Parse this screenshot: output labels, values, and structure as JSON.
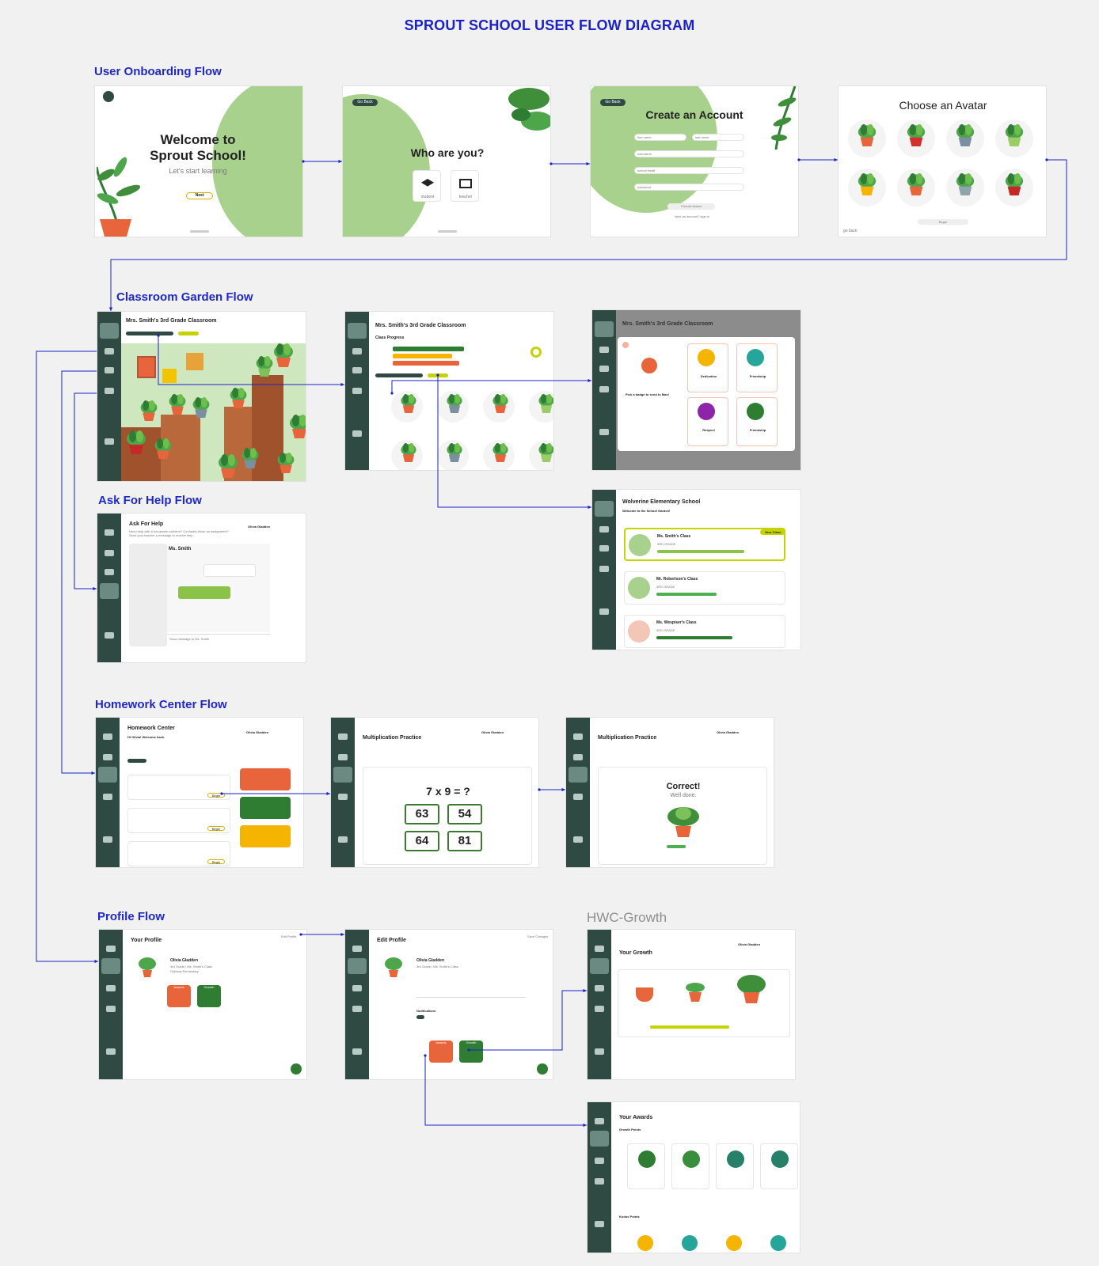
{
  "title": "SPROUT SCHOOL USER FLOW DIAGRAM",
  "sections": {
    "onboarding": "User Onboarding Flow",
    "garden": "Classroom Garden Flow",
    "help": "Ask For Help Flow",
    "homework": "Homework Center Flow",
    "profile": "Profile Flow",
    "growth": "HWC-Growth"
  },
  "screens": {
    "welcome": {
      "line1": "Welcome to",
      "line2": "Sprout School!",
      "sub": "Let's start learning",
      "button": "Next"
    },
    "who": {
      "heading": "Who are you?",
      "back": "Go Back",
      "student": "student",
      "teacher": "teacher"
    },
    "account": {
      "heading": "Create an Account",
      "back": "Go Back",
      "first": "first name",
      "last": "last name",
      "username": "username",
      "email": "school email",
      "password": "password",
      "choose": "Choose Avatar",
      "signin": "have an account? sign in"
    },
    "avatar": {
      "heading": "Choose an Avatar",
      "back": "go back",
      "begin": "Begin"
    },
    "classroom": {
      "heading": "Mrs. Smith's 3rd Grade Classroom"
    },
    "progress": {
      "heading": "Mrs. Smith's 3rd Grade Classroom",
      "sub": "Class Progress"
    },
    "badges": {
      "heading": "Mrs. Smith's 3rd Grade Classroom",
      "pick": "Pick a badge to send to Max!",
      "b1": "Dedication",
      "b2": "Friendship",
      "b3": "Respect",
      "b4": "Friendship"
    },
    "school": {
      "heading": "Wolverine Elementary School",
      "sub": "Welcome to the School Garden!",
      "c1": "Ms. Smith's Class",
      "c2": "Mr. Robertson's Class",
      "c3": "Ms. Wespiser's Class",
      "grade": "3RD GRADE",
      "yours": "Your Class"
    },
    "help": {
      "heading": "Ask For Help",
      "sub1": "Need help with a homework problem? Confused about an assignment?",
      "sub2": "Send your teacher a message to receive help.",
      "teacher": "Ms. Smith",
      "student": "Olivia Gladden",
      "placeholder": "Send message to Ms. Smith"
    },
    "homework": {
      "heading": "Homework Center",
      "hello": "Hi Olivia! Welcome back.",
      "student": "Olivia Gladden",
      "begin": "Begin"
    },
    "practice": {
      "heading": "Multiplication Practice",
      "equation": "7 x 9 = ?",
      "a1": "63",
      "a2": "54",
      "a3": "64",
      "a4": "81",
      "student": "Olivia Gladden"
    },
    "correct": {
      "heading": "Multiplication Practice",
      "result": "Correct!",
      "well": "Well done.",
      "student": "Olivia Gladden"
    },
    "profile": {
      "heading": "Your Profile",
      "name": "Olivia Gladden",
      "grade": "3rd Grade | Ms. Smith's Class",
      "school": "Oakway Elementary",
      "edit": "Edit Profile",
      "awards": "Awards",
      "growth": "Growth"
    },
    "editprofile": {
      "heading": "Edit Profile",
      "name": "Olivia Gladden",
      "grade": "3rd Grade | Ms. Smith's Class",
      "save": "Save Changes",
      "awards": "Awards",
      "growth": "Growth",
      "notifications": "Notifications"
    },
    "yourgrowth": {
      "heading": "Your Growth",
      "student": "Olivia Gladden"
    },
    "awards": {
      "heading": "Your Awards",
      "growth": "Growth Points",
      "kudos": "Kudos Points"
    }
  },
  "colors": {
    "accent": "#1a22c8",
    "sidebar": "#2e4a43",
    "leaf": "#a9d18e",
    "green": "#2e7d32",
    "orange": "#e8643a",
    "yellow": "#f4b400"
  }
}
